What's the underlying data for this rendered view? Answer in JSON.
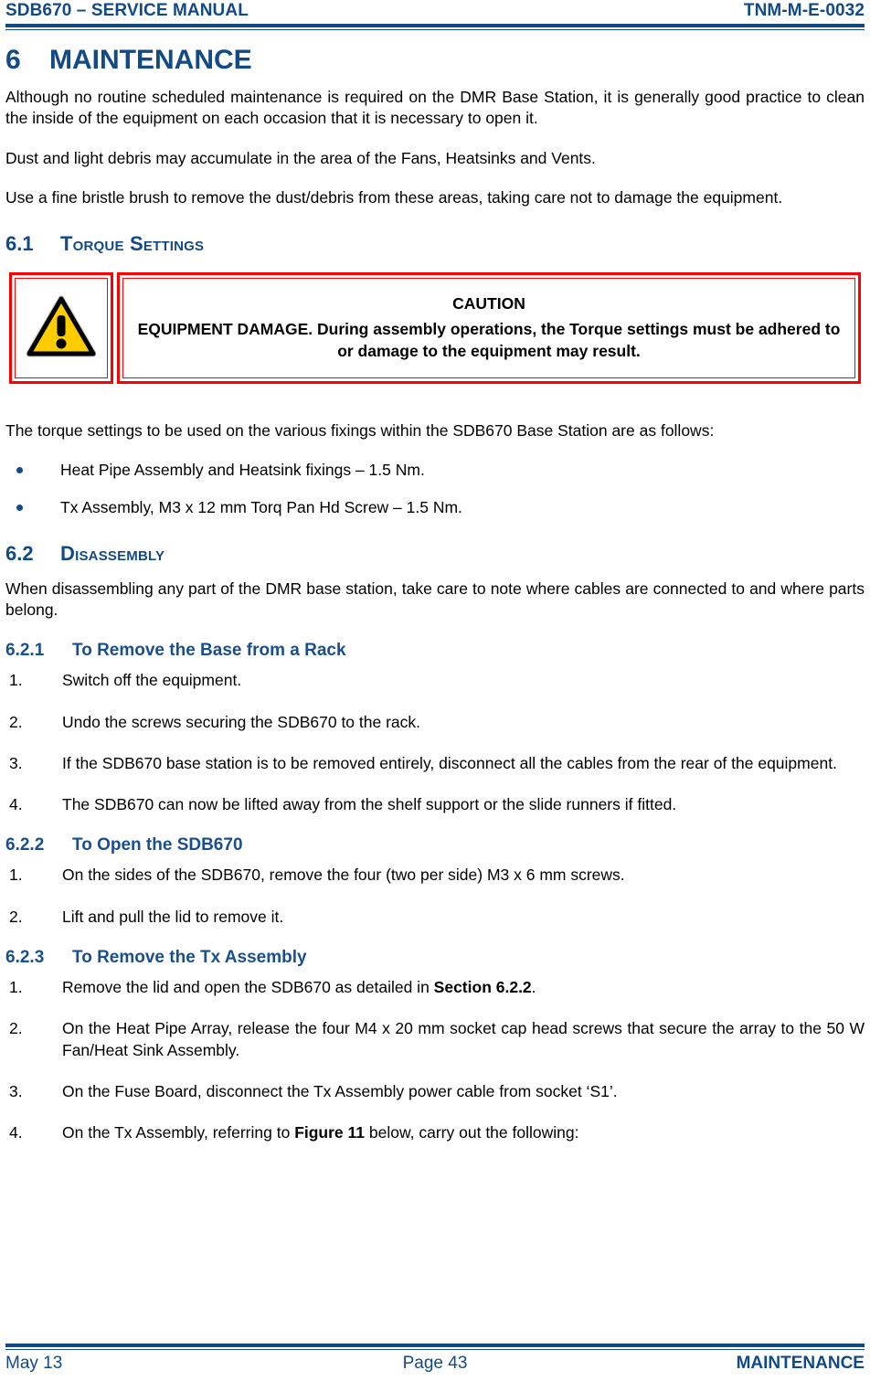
{
  "header": {
    "left": "SDB670 – SERVICE MANUAL",
    "right": "TNM-M-E-0032"
  },
  "colors": {
    "heading_blue": "#124A86",
    "caution_red": "#FF0000",
    "warning_yellow": "#FFCC00",
    "body_black": "#000000"
  },
  "section": {
    "number": "6",
    "title": "MAINTENANCE",
    "intro_paragraphs": [
      "Although no routine scheduled maintenance is required on the DMR Base Station, it is generally good practice to clean the inside of the equipment on each occasion that it is necessary to open it.",
      "Dust and light debris may accumulate in the area of the Fans, Heatsinks and Vents.",
      "Use a fine bristle brush to remove the dust/debris from these areas, taking care not to damage the equipment."
    ]
  },
  "subsection_61": {
    "number": "6.1",
    "title": "Torque Settings",
    "caution": {
      "icon": "warning-triangle-icon",
      "title": "CAUTION",
      "text": "EQUIPMENT DAMAGE.  During assembly operations, the Torque settings must be adhered to or damage to the equipment may result."
    },
    "lead_paragraph": "The torque settings to be used on the various fixings within the SDB670 Base Station are as follows:",
    "bullets": [
      "Heat Pipe Assembly and Heatsink fixings – 1.5 Nm.",
      "Tx Assembly, M3 x 12 mm Torq Pan Hd Screw – 1.5 Nm."
    ]
  },
  "subsection_62": {
    "number": "6.2",
    "title": "Disassembly",
    "lead_paragraph": "When disassembling any part of the DMR base station, take care to note where cables are connected to and where parts belong."
  },
  "subsection_621": {
    "number": "6.2.1",
    "title": "To Remove the Base from a Rack",
    "steps": [
      {
        "n": "1.",
        "text": "Switch off the equipment."
      },
      {
        "n": "2.",
        "text": "Undo the screws securing the SDB670 to the rack."
      },
      {
        "n": "3.",
        "text": "If the SDB670 base station is to be removed entirely, disconnect all the cables from the rear of the equipment."
      },
      {
        "n": "4.",
        "text": "The SDB670 can now be lifted away from the shelf support or the slide runners if fitted."
      }
    ]
  },
  "subsection_622": {
    "number": "6.2.2",
    "title": "To Open the SDB670",
    "steps": [
      {
        "n": "1.",
        "text": "On the sides of the SDB670, remove the four (two per side) M3 x 6 mm screws."
      },
      {
        "n": "2.",
        "text": "Lift and pull the lid to remove it."
      }
    ]
  },
  "subsection_623": {
    "number": "6.2.3",
    "title": "To Remove the Tx Assembly",
    "steps": [
      {
        "n": "1.",
        "pre": "Remove the lid and open the SDB670 as detailed in ",
        "bold": "Section 6.2.2",
        "post": "."
      },
      {
        "n": "2.",
        "pre": "On the Heat Pipe Array, release the four M4 x 20 mm socket cap head screws that secure the array to the 50 W Fan/Heat Sink Assembly.",
        "bold": "",
        "post": ""
      },
      {
        "n": "3.",
        "pre": "On the Fuse Board, disconnect the Tx Assembly power cable from socket ‘S1’.",
        "bold": "",
        "post": ""
      },
      {
        "n": "4.",
        "pre": "On the Tx Assembly, referring to ",
        "bold": "Figure 11",
        "post": " below, carry out the following:"
      }
    ]
  },
  "footer": {
    "left": "May 13",
    "center": "Page 43",
    "right": "MAINTENANCE"
  }
}
